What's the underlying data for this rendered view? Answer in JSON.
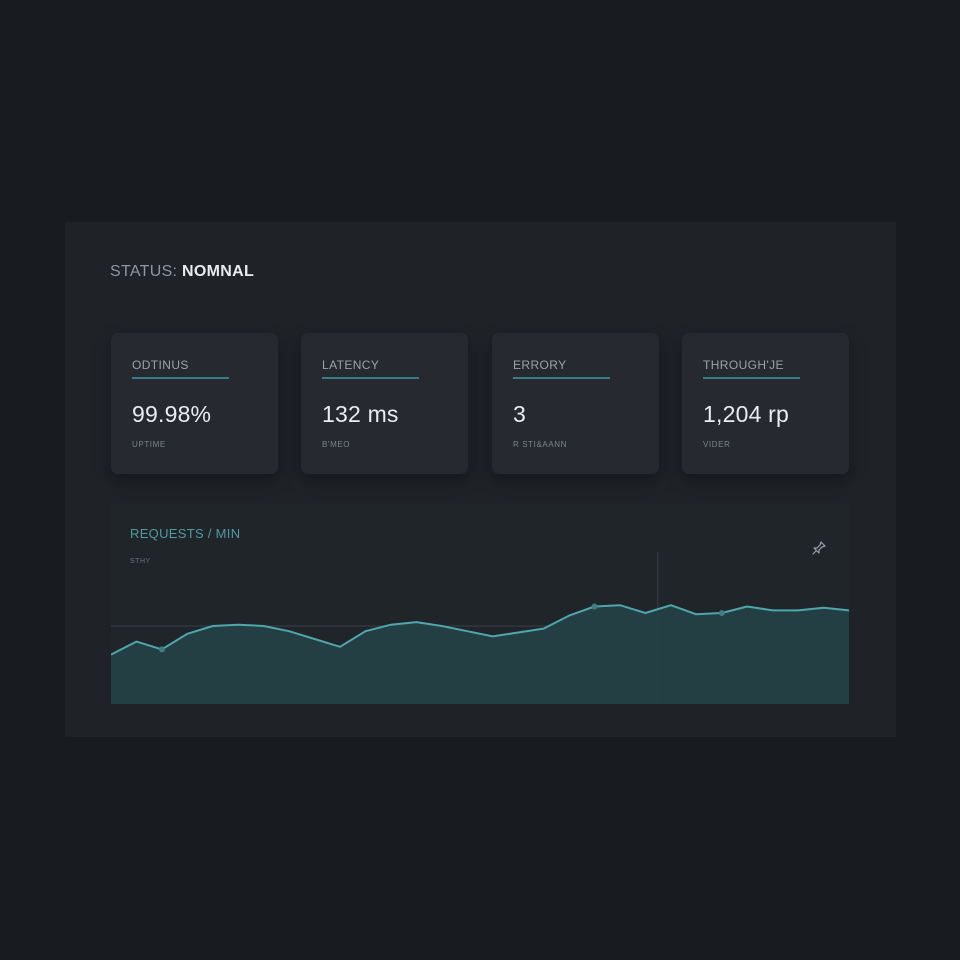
{
  "status": {
    "label": "STATUS:",
    "value": "NOMNAL"
  },
  "cards": [
    {
      "label": "ODTINUS",
      "value": "99.98%",
      "sub": "UPTIME"
    },
    {
      "label": "LATENCY",
      "value": "132 ms",
      "sub": "B'MEO"
    },
    {
      "label": "ERRORY",
      "value": "3",
      "sub": "R STI&AANN"
    },
    {
      "label": "THROUGH'JE",
      "value": "1,204 rp",
      "sub": "VIDER"
    }
  ],
  "chart": {
    "title": "REQUESTS / MIN",
    "subtitle": "STHY",
    "action_icon": "pin-icon"
  },
  "colors": {
    "accent": "#4fa6ad",
    "fill": "#234246",
    "panel": "#1f2328",
    "card": "#262a30",
    "background": "#181c20"
  },
  "chart_data": {
    "type": "area",
    "title": "REQUESTS / MIN",
    "x": [
      0,
      1,
      2,
      3,
      4,
      5,
      6,
      7,
      8,
      9,
      10,
      11,
      12,
      13,
      14,
      15,
      16,
      17,
      18,
      19,
      20,
      21,
      22,
      23,
      24,
      25,
      26,
      27,
      28,
      29
    ],
    "values": [
      38,
      48,
      42,
      54,
      60,
      61,
      60,
      56,
      50,
      44,
      56,
      61,
      63,
      60,
      56,
      52,
      55,
      58,
      68,
      75,
      76,
      70,
      76,
      69,
      70,
      75,
      72,
      72,
      74,
      72
    ],
    "ylim": [
      0,
      100
    ],
    "grid": false,
    "markers": [
      2,
      19,
      24
    ]
  }
}
